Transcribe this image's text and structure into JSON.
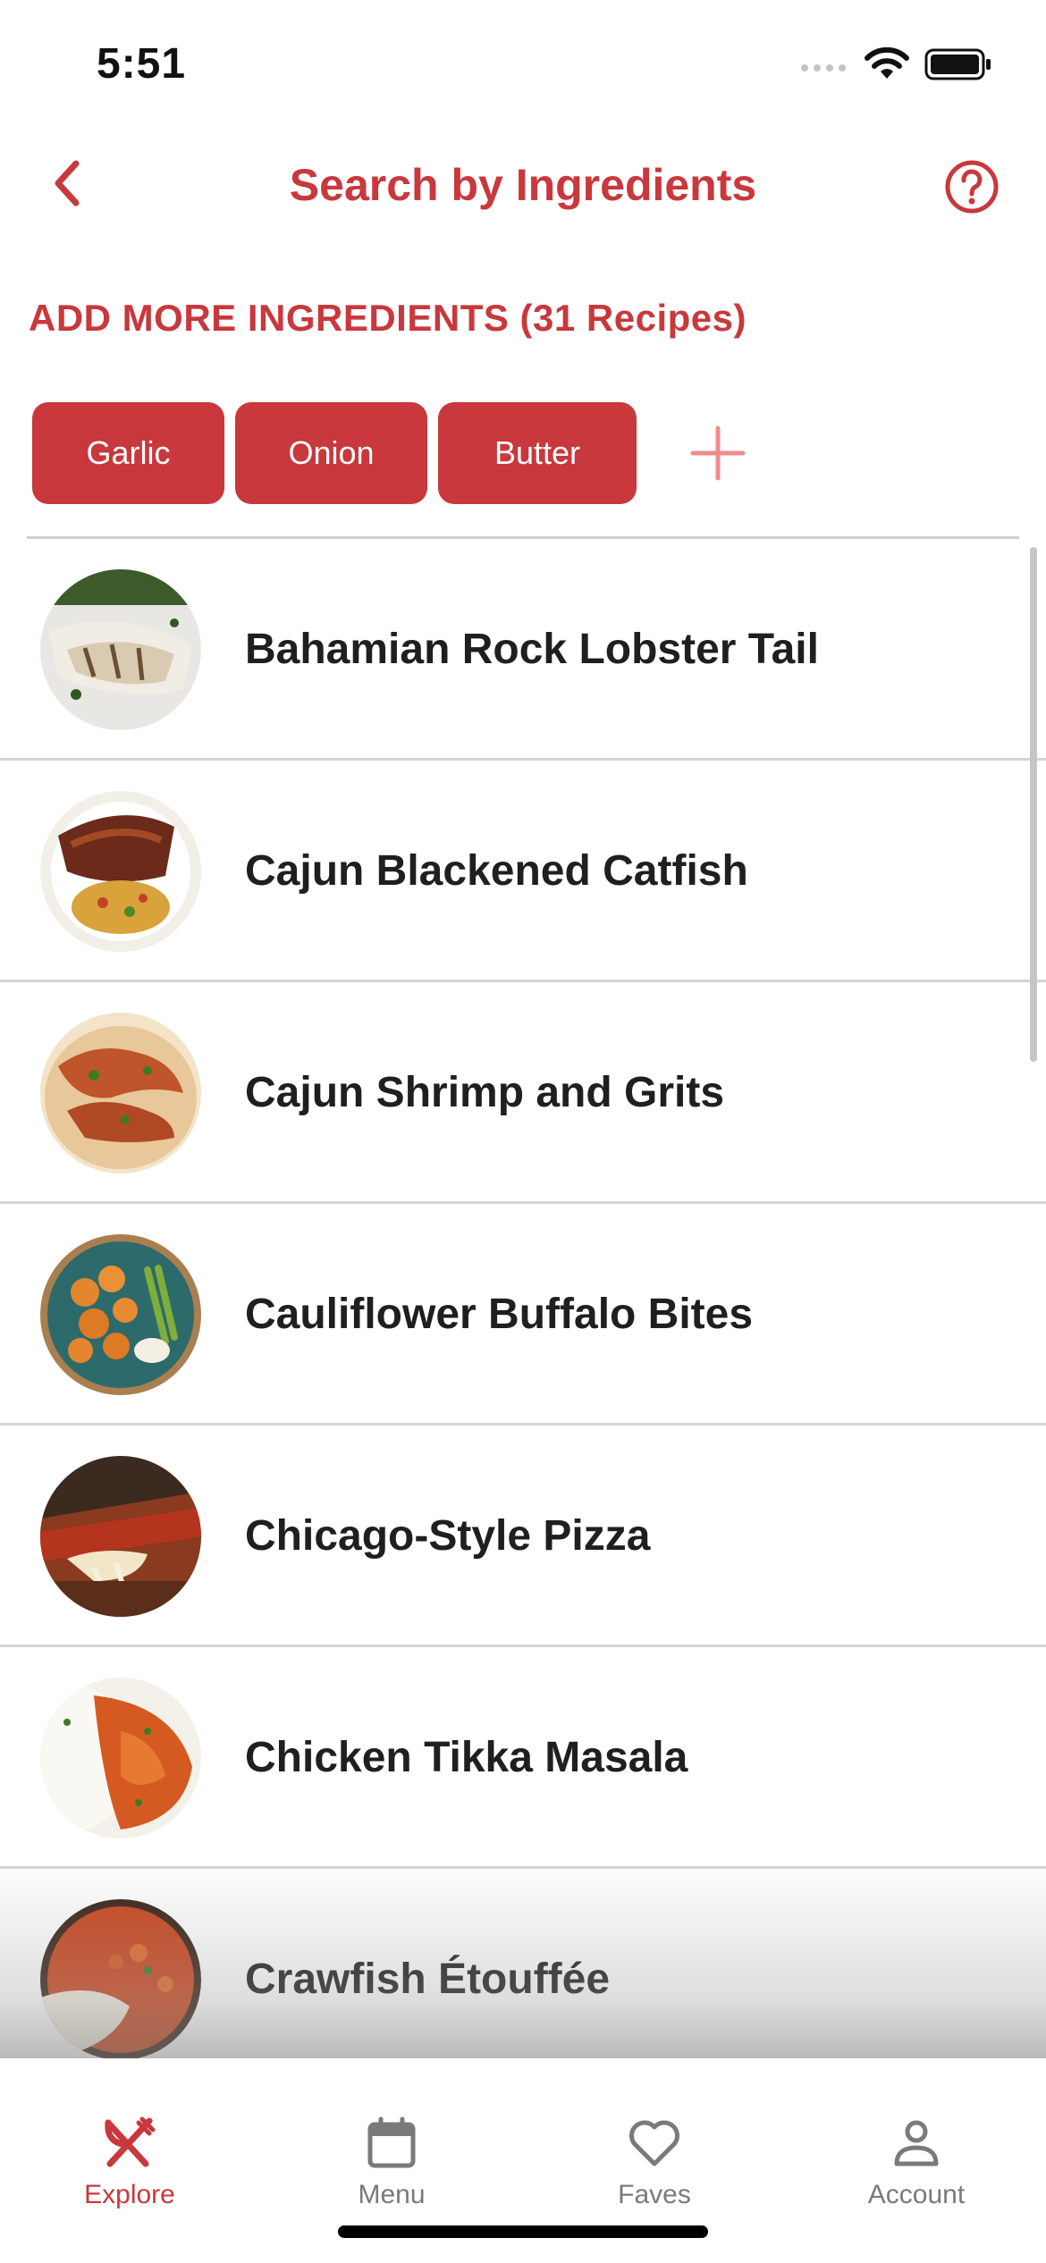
{
  "status_bar": {
    "time": "5:51"
  },
  "header": {
    "title": "Search by Ingredients"
  },
  "ingredients_heading": "ADD MORE INGREDIENTS (31 Recipes)",
  "ingredients": [
    "Garlic",
    "Onion",
    "Butter"
  ],
  "recipes": [
    "Bahamian Rock Lobster Tail",
    "Cajun Blackened Catfish",
    "Cajun Shrimp and Grits",
    "Cauliflower Buffalo Bites",
    "Chicago-Style Pizza",
    "Chicken Tikka Masala",
    "Crawfish Étouffée"
  ],
  "tabs": [
    {
      "label": "Explore",
      "icon": "fork-knife-icon",
      "active": true
    },
    {
      "label": "Menu",
      "icon": "calendar-icon",
      "active": false
    },
    {
      "label": "Faves",
      "icon": "heart-icon",
      "active": false
    },
    {
      "label": "Account",
      "icon": "person-icon",
      "active": false
    }
  ],
  "colors": {
    "accent": "#c8383c",
    "accent_light": "#ee8c8c",
    "inactive": "#7a7a7a"
  }
}
